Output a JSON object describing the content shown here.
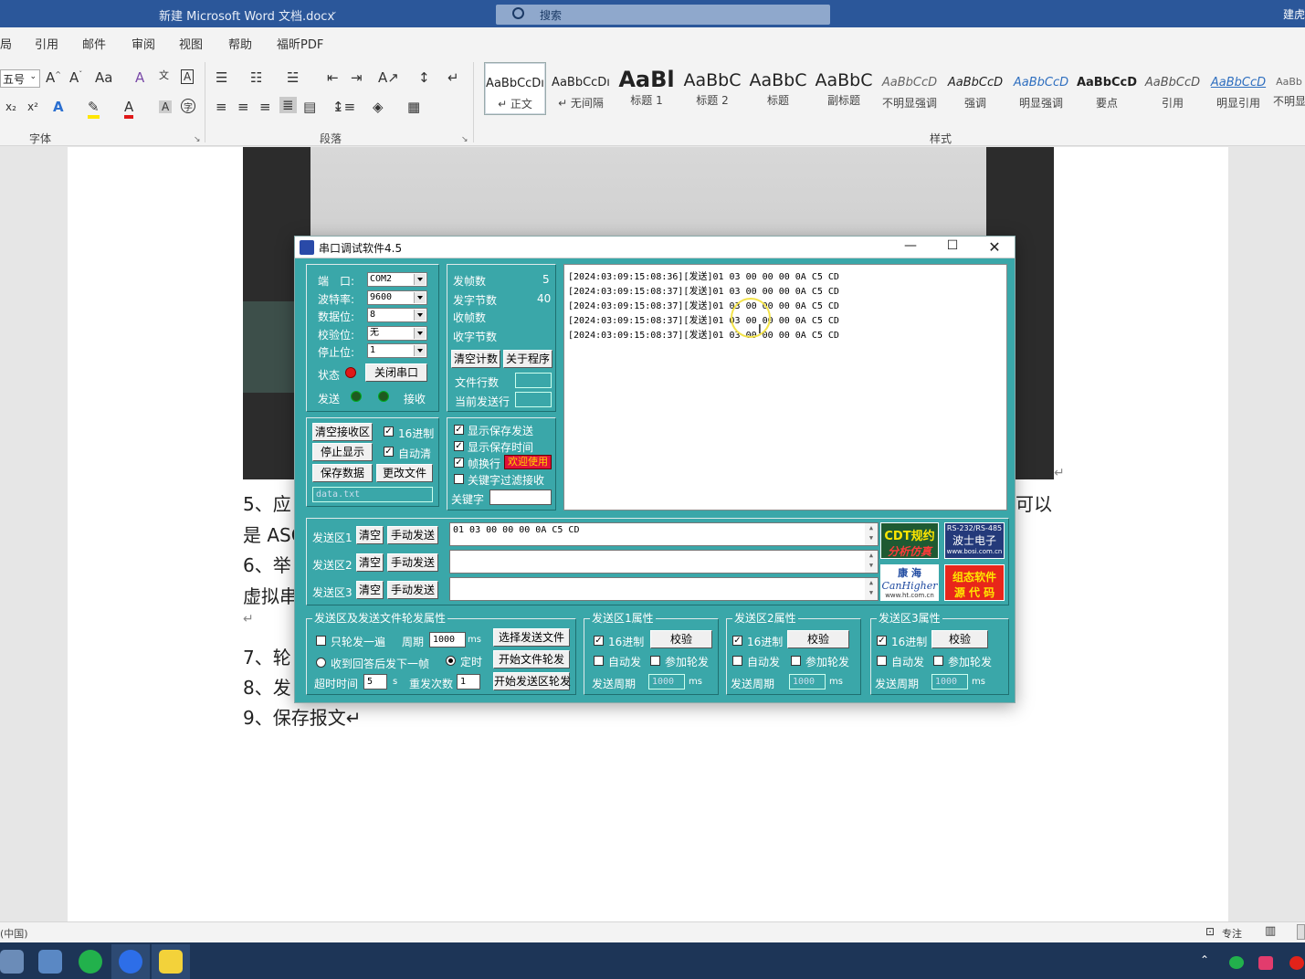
{
  "word": {
    "doc_title": "新建 Microsoft Word 文档.docx",
    "search_placeholder": "搜索",
    "user": "建虎",
    "tabs": [
      "局",
      "引用",
      "邮件",
      "审阅",
      "视图",
      "帮助",
      "福昕PDF"
    ],
    "font_size": "五号",
    "group_font": "字体",
    "group_paragraph": "段落",
    "group_styles": "样式",
    "styles": [
      {
        "sample": "AaBbCcDı",
        "name": "↵ 正文"
      },
      {
        "sample": "AaBbCcDı",
        "name": "↵ 无间隔"
      },
      {
        "sample": "AaBl",
        "name": "标题 1"
      },
      {
        "sample": "AaBbC",
        "name": "标题 2"
      },
      {
        "sample": "AaBbC",
        "name": "标题"
      },
      {
        "sample": "AaBbC",
        "name": "副标题"
      },
      {
        "sample": "AaBbCcD",
        "name": "不明显强调"
      },
      {
        "sample": "AaBbCcD",
        "name": "强调"
      },
      {
        "sample": "AaBbCcD",
        "name": "明显强调"
      },
      {
        "sample": "AaBbCcD",
        "name": "要点"
      },
      {
        "sample": "AaBbCcD",
        "name": "引用"
      },
      {
        "sample": "AaBbCcD",
        "name": "明显引用"
      },
      {
        "sample": "AaBb",
        "name": "不明显"
      }
    ],
    "doc_lines": [
      "5、应",
      "是 ASC",
      "6、举",
      "虚拟串",
      "↵",
      "7、轮",
      "8、发",
      "9、保存报文↵"
    ],
    "doc_right_fragment": "可以",
    "status_lang": "(中国)",
    "status_focus": "专注"
  },
  "serial": {
    "title": "串口调试软件4.5",
    "port_label": "端　口:",
    "port_value": "COM2",
    "baud_label": "波特率:",
    "baud_value": "9600",
    "databits_label": "数据位:",
    "databits_value": "8",
    "parity_label": "校验位:",
    "parity_value": "无",
    "stopbits_label": "停止位:",
    "stopbits_value": "1",
    "state_label": "状态",
    "close_port": "关闭串口",
    "send_label": "发送",
    "recv_label": "接收",
    "sent_frames_label": "发帧数",
    "sent_frames": "5",
    "sent_bytes_label": "发字节数",
    "sent_bytes": "40",
    "recv_frames_label": "收帧数",
    "recv_bytes_label": "收字节数",
    "clear_count": "清空计数",
    "about": "关于程序",
    "file_lines_label": "文件行数",
    "current_line_label": "当前发送行",
    "clear_recv": "清空接收区",
    "hex16": "16进制",
    "stop_display": "停止显示",
    "auto_clear": "自动清",
    "save_data": "保存数据",
    "change_file": "更改文件",
    "filename": "data.txt",
    "show_saved_send": "显示保存发送",
    "show_saved_time": "显示保存时间",
    "frame_newline": "帧换行",
    "welcome": "欢迎使用",
    "keyword_filter": "关键字过滤接收",
    "keyword_label": "关键字",
    "recv_lines": [
      "[2024:03:09:15:08:36][发送]01 03 00 00 00 0A C5 CD",
      "[2024:03:09:15:08:37][发送]01 03 00 00 00 0A C5 CD",
      "[2024:03:09:15:08:37][发送]01 03 00 00 00 0A C5 CD",
      "[2024:03:09:15:08:37][发送]01 03 00 00 00 0A C5 CD",
      "[2024:03:09:15:08:37][发送]01 03 00 00 00 0A C5 CD"
    ],
    "send_areas": [
      {
        "label": "发送区1",
        "clear": "清空",
        "manual": "手动发送",
        "value": "01 03 00 00 00 0A C5 CD"
      },
      {
        "label": "发送区2",
        "clear": "清空",
        "manual": "手动发送",
        "value": ""
      },
      {
        "label": "发送区3",
        "clear": "清空",
        "manual": "手动发送",
        "value": ""
      }
    ],
    "ads": {
      "cdt_1": "CDT规约",
      "cdt_2": "分析仿真",
      "bosi_top": "RS-232/RS-485",
      "bosi_mid": "波士电子",
      "bosi_url": "www.bosi.com.cn",
      "canhigher_1": "康 海",
      "canhigher_2": "CanHigher",
      "canhigher_url": "www.ht.com.cn",
      "zutai_1": "组态软件",
      "zutai_2": "源 代 码"
    },
    "rotate": {
      "title": "发送区及发送文件轮发属性",
      "once": "只轮发一遍",
      "period_label": "周期",
      "period": "1000",
      "ms": "ms",
      "select_file": "选择发送文件",
      "after_reply": "收到回答后发下一帧",
      "timed": "定时",
      "start_file": "开始文件轮发",
      "timeout_label": "超时时间",
      "timeout": "5",
      "s": "s",
      "retry_label": "重发次数",
      "retry": "1",
      "start_area": "开始发送区轮发"
    },
    "area_props": [
      {
        "title": "发送区1属性",
        "hex": "16进制",
        "check": "校验",
        "auto": "自动发",
        "join": "参加轮发",
        "period_label": "发送周期",
        "period": "1000",
        "ms": "ms"
      },
      {
        "title": "发送区2属性",
        "hex": "16进制",
        "check": "校验",
        "auto": "自动发",
        "join": "参加轮发",
        "period_label": "发送周期",
        "period": "1000",
        "ms": "ms"
      },
      {
        "title": "发送区3属性",
        "hex": "16进制",
        "check": "校验",
        "auto": "自动发",
        "join": "参加轮发",
        "period_label": "发送周期",
        "period": "1000",
        "ms": "ms"
      }
    ]
  },
  "colors": {
    "word_blue": "#2b579a",
    "serial_teal": "#3aa7a9",
    "led_red": "#e01818",
    "led_green": "#1f5a1f",
    "welcome_bg": "#e0103a"
  }
}
